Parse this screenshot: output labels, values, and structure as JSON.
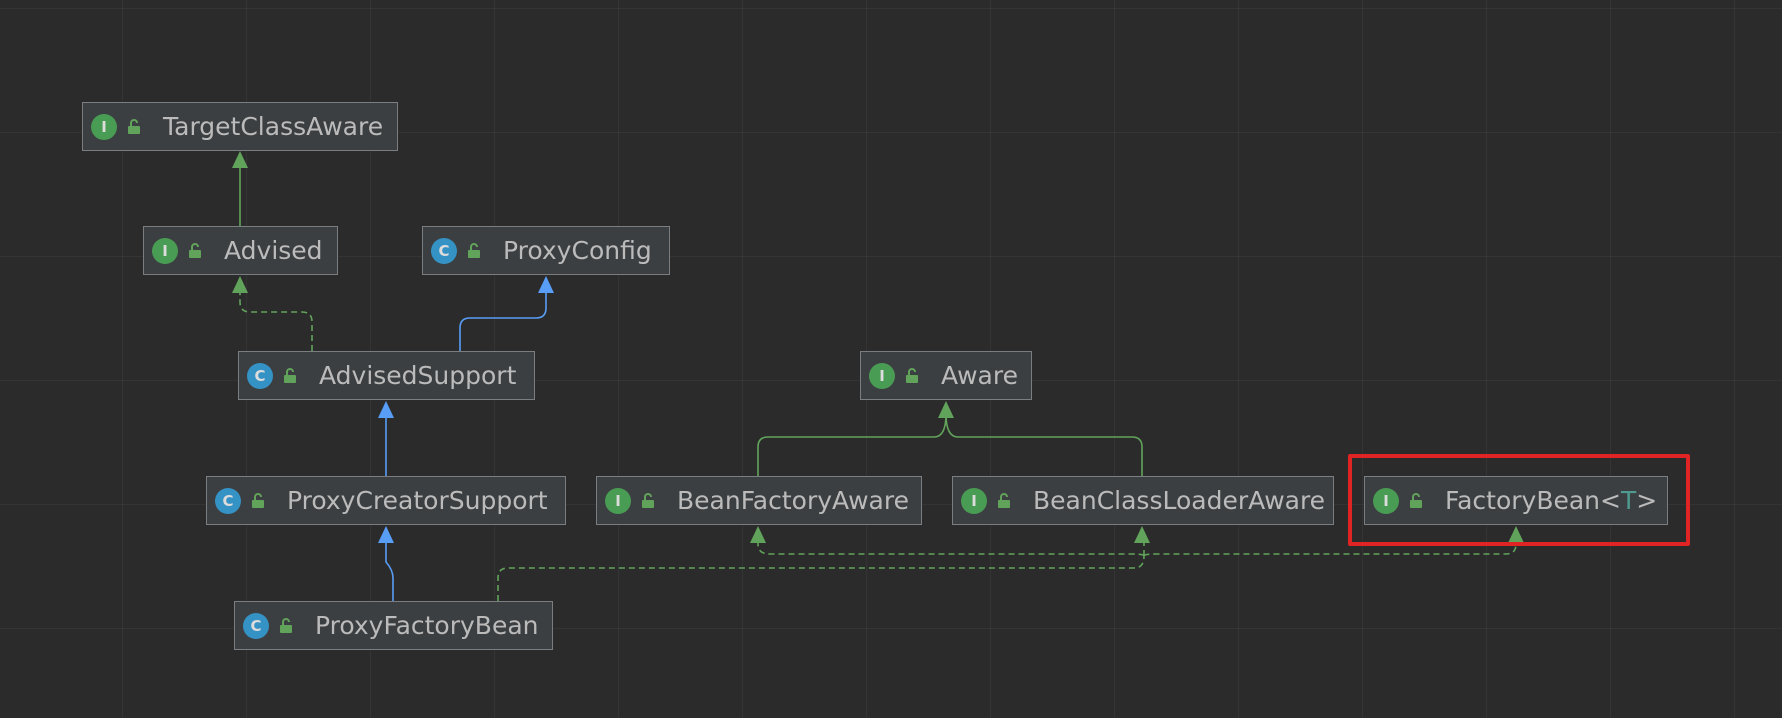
{
  "colors": {
    "background": "#2b2b2b",
    "node_fill": "#3c3f41",
    "node_border": "#7b7e80",
    "text": "#bbbbbb",
    "interface_badge": "#499c54",
    "class_badge": "#3592c4",
    "extends_arrow": "#589df6",
    "implements_arrow": "#62a35b",
    "generic_param": "#4e9a8e",
    "highlight": "#e02424"
  },
  "nodes": [
    {
      "id": "TargetClassAware",
      "label": "TargetClassAware",
      "kind": "interface",
      "badge": "I",
      "icon": "unlocked-padlock-icon"
    },
    {
      "id": "Advised",
      "label": "Advised",
      "kind": "interface",
      "badge": "I",
      "icon": "unlocked-padlock-icon"
    },
    {
      "id": "ProxyConfig",
      "label": "ProxyConfig",
      "kind": "class",
      "badge": "C",
      "icon": "unlocked-padlock-icon"
    },
    {
      "id": "AdvisedSupport",
      "label": "AdvisedSupport",
      "kind": "class",
      "badge": "C",
      "icon": "unlocked-padlock-icon"
    },
    {
      "id": "Aware",
      "label": "Aware",
      "kind": "interface",
      "badge": "I",
      "icon": "unlocked-padlock-icon"
    },
    {
      "id": "ProxyCreatorSupport",
      "label": "ProxyCreatorSupport",
      "kind": "class",
      "badge": "C",
      "icon": "unlocked-padlock-icon"
    },
    {
      "id": "BeanFactoryAware",
      "label": "BeanFactoryAware",
      "kind": "interface",
      "badge": "I",
      "icon": "unlocked-padlock-icon"
    },
    {
      "id": "BeanClassLoaderAware",
      "label": "BeanClassLoaderAware",
      "kind": "interface",
      "badge": "I",
      "icon": "unlocked-padlock-icon"
    },
    {
      "id": "FactoryBean",
      "label": "FactoryBean",
      "type_param": "T",
      "kind": "interface",
      "badge": "I",
      "icon": "unlocked-padlock-icon",
      "highlighted": true
    },
    {
      "id": "ProxyFactoryBean",
      "label": "ProxyFactoryBean",
      "kind": "class",
      "badge": "C",
      "icon": "unlocked-padlock-icon"
    }
  ],
  "edges": [
    {
      "from": "Advised",
      "to": "TargetClassAware",
      "relation": "extends",
      "style": "solid"
    },
    {
      "from": "AdvisedSupport",
      "to": "Advised",
      "relation": "implements",
      "style": "dashed"
    },
    {
      "from": "AdvisedSupport",
      "to": "ProxyConfig",
      "relation": "extends",
      "style": "solid"
    },
    {
      "from": "ProxyCreatorSupport",
      "to": "AdvisedSupport",
      "relation": "extends",
      "style": "solid"
    },
    {
      "from": "ProxyFactoryBean",
      "to": "ProxyCreatorSupport",
      "relation": "extends",
      "style": "solid"
    },
    {
      "from": "BeanFactoryAware",
      "to": "Aware",
      "relation": "extends",
      "style": "solid"
    },
    {
      "from": "BeanClassLoaderAware",
      "to": "Aware",
      "relation": "extends",
      "style": "solid"
    },
    {
      "from": "ProxyFactoryBean",
      "to": "BeanFactoryAware",
      "relation": "implements",
      "style": "dashed"
    },
    {
      "from": "ProxyFactoryBean",
      "to": "BeanClassLoaderAware",
      "relation": "implements",
      "style": "dashed"
    },
    {
      "from": "ProxyFactoryBean",
      "to": "FactoryBean",
      "relation": "implements",
      "style": "dashed"
    }
  ]
}
